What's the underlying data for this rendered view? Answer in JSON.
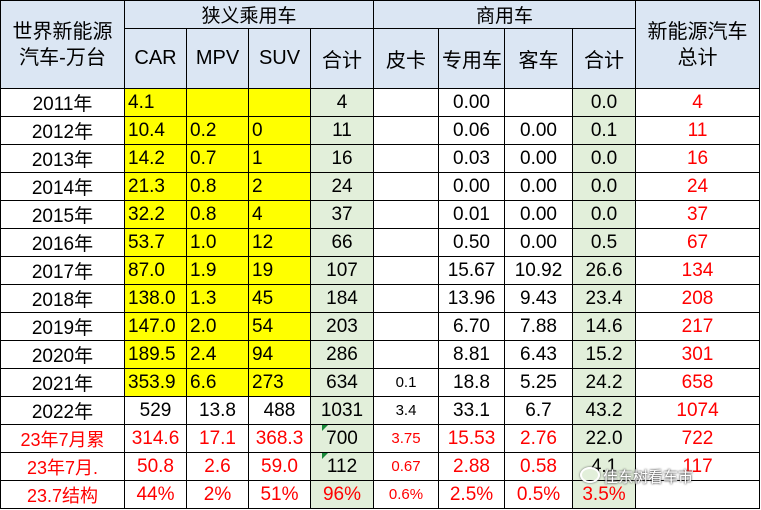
{
  "header": {
    "corner": "世界新能源汽车-万台",
    "group_passenger": "狭义乘用车",
    "group_commercial": "商用车",
    "total_label": "新能源汽车总计",
    "cols": [
      "CAR",
      "MPV",
      "SUV",
      "合计",
      "皮卡",
      "专用车",
      "客车",
      "合计"
    ]
  },
  "rows": [
    {
      "year": "2011年",
      "car": "4.1",
      "mpv": "",
      "suv": "",
      "pass_total": "4",
      "pickup": "",
      "special": "0.00",
      "bus": "",
      "comm_total": "0.0",
      "grand_total": "4"
    },
    {
      "year": "2012年",
      "car": "10.4",
      "mpv": "0.2",
      "suv": "0",
      "pass_total": "11",
      "pickup": "",
      "special": "0.06",
      "bus": "0.00",
      "comm_total": "0.1",
      "grand_total": "11"
    },
    {
      "year": "2013年",
      "car": "14.2",
      "mpv": "0.7",
      "suv": "1",
      "pass_total": "16",
      "pickup": "",
      "special": "0.03",
      "bus": "0.00",
      "comm_total": "0.0",
      "grand_total": "16"
    },
    {
      "year": "2014年",
      "car": "21.3",
      "mpv": "0.8",
      "suv": "2",
      "pass_total": "24",
      "pickup": "",
      "special": "0.00",
      "bus": "0.00",
      "comm_total": "0.0",
      "grand_total": "24"
    },
    {
      "year": "2015年",
      "car": "32.2",
      "mpv": "0.8",
      "suv": "4",
      "pass_total": "37",
      "pickup": "",
      "special": "0.01",
      "bus": "0.00",
      "comm_total": "0.0",
      "grand_total": "37"
    },
    {
      "year": "2016年",
      "car": "53.7",
      "mpv": "1.0",
      "suv": "12",
      "pass_total": "66",
      "pickup": "",
      "special": "0.50",
      "bus": "0.00",
      "comm_total": "0.5",
      "grand_total": "67"
    },
    {
      "year": "2017年",
      "car": "87.0",
      "mpv": "1.9",
      "suv": "19",
      "pass_total": "107",
      "pickup": "",
      "special": "15.67",
      "bus": "10.92",
      "comm_total": "26.6",
      "grand_total": "134"
    },
    {
      "year": "2018年",
      "car": "138.0",
      "mpv": "1.3",
      "suv": "45",
      "pass_total": "184",
      "pickup": "",
      "special": "13.96",
      "bus": "9.43",
      "comm_total": "23.4",
      "grand_total": "208"
    },
    {
      "year": "2019年",
      "car": "147.0",
      "mpv": "2.0",
      "suv": "54",
      "pass_total": "203",
      "pickup": "",
      "special": "6.70",
      "bus": "7.88",
      "comm_total": "14.6",
      "grand_total": "217"
    },
    {
      "year": "2020年",
      "car": "189.5",
      "mpv": "2.4",
      "suv": "94",
      "pass_total": "286",
      "pickup": "",
      "special": "8.81",
      "bus": "6.43",
      "comm_total": "15.2",
      "grand_total": "301"
    },
    {
      "year": "2021年",
      "car": "353.9",
      "mpv": "6.6",
      "suv": "273",
      "pass_total": "634",
      "pickup": "0.1",
      "special": "18.8",
      "bus": "5.25",
      "comm_total": "24.2",
      "grand_total": "658"
    },
    {
      "year": "2022年",
      "car": "529",
      "mpv": "13.8",
      "suv": "488",
      "pass_total": "1031",
      "pickup": "3.4",
      "special": "33.1",
      "bus": "6.7",
      "comm_total": "43.2",
      "grand_total": "1074"
    }
  ],
  "summary_rows": [
    {
      "label": "23年7月累",
      "car": "314.6",
      "mpv": "17.1",
      "suv": "368.3",
      "pass_total": "700",
      "pickup": "3.75",
      "special": "15.53",
      "bus": "2.76",
      "comm_total": "22.0",
      "grand_total": "722"
    },
    {
      "label": "23年7月.",
      "car": "50.8",
      "mpv": "2.6",
      "suv": "59.0",
      "pass_total": "112",
      "pickup": "0.67",
      "special": "2.88",
      "bus": "0.58",
      "comm_total": "4.1",
      "grand_total": "117"
    },
    {
      "label": "23.7结构",
      "car": "44%",
      "mpv": "2%",
      "suv": "51%",
      "pass_total": "96%",
      "pickup": "0.6%",
      "special": "2.5%",
      "bus": "0.5%",
      "comm_total": "3.5%",
      "grand_total": ""
    }
  ],
  "watermark": "佳东树看车市",
  "colors": {
    "header_bg": "#dbe6f3",
    "highlight_yellow": "#ffff00",
    "total_green": "#e2efda",
    "red_text": "#ff0000"
  }
}
